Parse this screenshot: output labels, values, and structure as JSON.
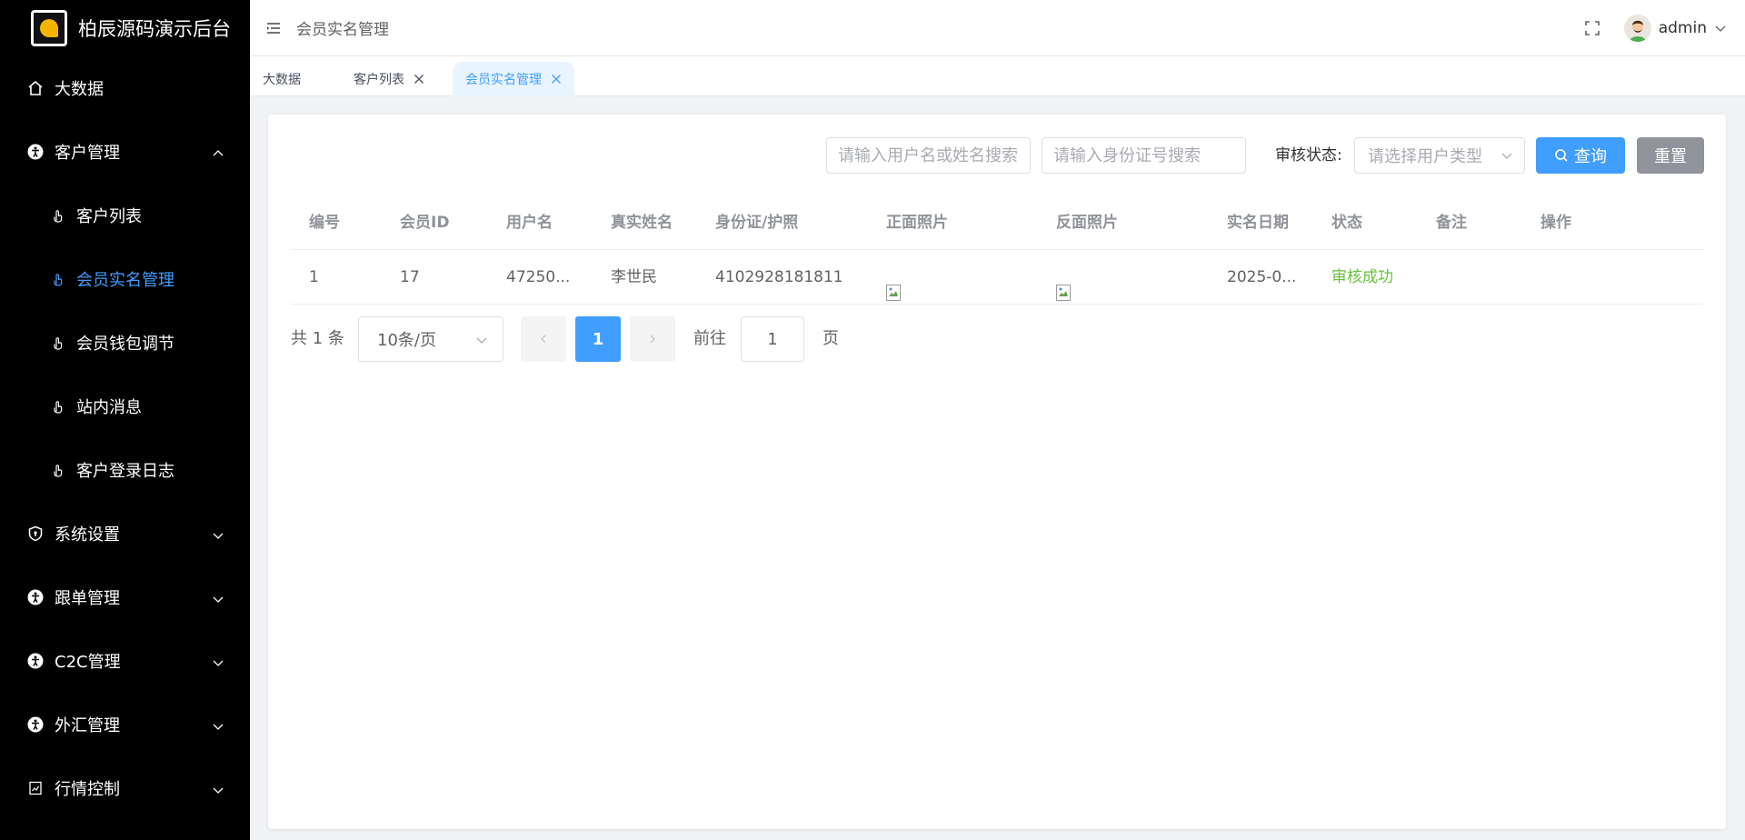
{
  "app": {
    "title": "柏辰源码演示后台"
  },
  "sidebar": {
    "items": [
      {
        "label": "大数据",
        "icon": "home-icon"
      },
      {
        "label": "客户管理",
        "icon": "accessibility-icon",
        "expanded": true,
        "children": [
          {
            "label": "客户列表",
            "active": false
          },
          {
            "label": "会员实名管理",
            "active": true
          },
          {
            "label": "会员钱包调节",
            "active": false
          },
          {
            "label": "站内消息",
            "active": false
          },
          {
            "label": "客户登录日志",
            "active": false
          }
        ]
      },
      {
        "label": "系统设置",
        "icon": "shield-icon"
      },
      {
        "label": "跟单管理",
        "icon": "accessibility-icon"
      },
      {
        "label": "C2C管理",
        "icon": "accessibility-icon"
      },
      {
        "label": "外汇管理",
        "icon": "accessibility-icon"
      },
      {
        "label": "行情控制",
        "icon": "chart-icon"
      }
    ]
  },
  "header": {
    "breadcrumb": "会员实名管理",
    "user": "admin"
  },
  "tabs": [
    {
      "label": "大数据",
      "closable": false,
      "active": false
    },
    {
      "label": "客户列表",
      "closable": true,
      "active": false
    },
    {
      "label": "会员实名管理",
      "closable": true,
      "active": true
    }
  ],
  "filters": {
    "username_placeholder": "请输入用户名或姓名搜索",
    "idcard_placeholder": "请输入身份证号搜索",
    "status_label": "审核状态:",
    "status_placeholder": "请选择用户类型",
    "query_label": "查询",
    "reset_label": "重置"
  },
  "table": {
    "columns": [
      "编号",
      "会员ID",
      "用户名",
      "真实姓名",
      "身份证/护照",
      "正面照片",
      "反面照片",
      "实名日期",
      "状态",
      "备注",
      "操作"
    ],
    "rows": [
      {
        "no": "1",
        "member_id": "17",
        "username": "47250...",
        "real_name": "李世民",
        "id_card": "4102928181811",
        "front": "",
        "back": "",
        "date": "2025-0...",
        "status": "审核成功",
        "remark": "",
        "ops": ""
      }
    ]
  },
  "pagination": {
    "total": "共 1 条",
    "page_size": "10条/页",
    "current": "1",
    "goto_label": "前往",
    "goto_value": "1",
    "unit": "页"
  },
  "colors": {
    "primary": "#409eff",
    "success": "#67c23a",
    "sidebar_bg": "#000000"
  }
}
